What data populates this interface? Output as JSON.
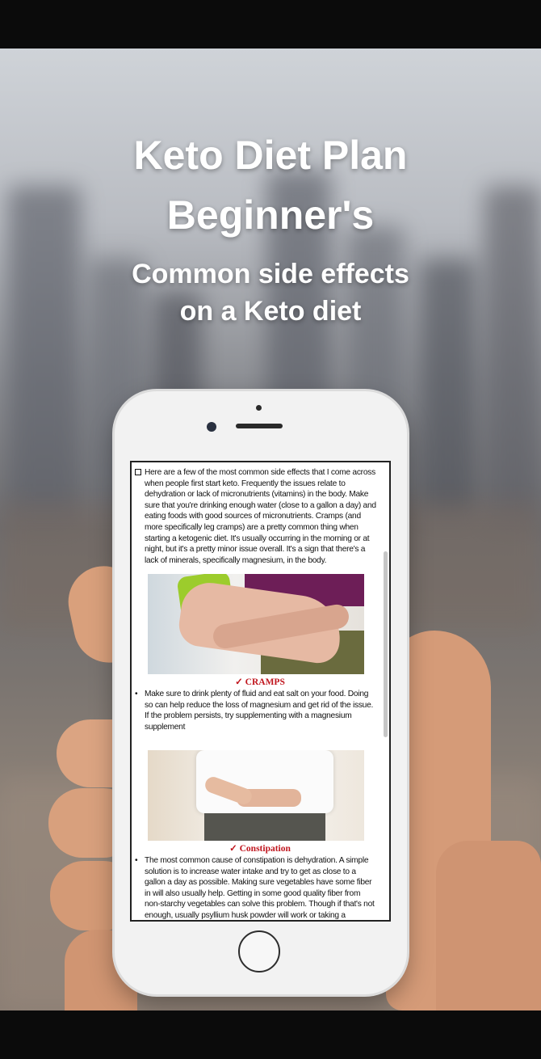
{
  "header": {
    "title_line1": "Keto Diet Plan",
    "title_line2": "Beginner's",
    "subtitle_line1": "Common side effects",
    "subtitle_line2": "on a Keto diet"
  },
  "article": {
    "intro": "Here are a few of the most common side effects that I come across when people first start keto. Frequently the issues relate to dehydration or lack of micronutrients (vitamins) in the body. Make sure that you're drinking enough water (close to a gallon a day) and eating foods with good sources of micronutrients. Cramps (and more specifically leg cramps) are a pretty common thing when starting a ketogenic diet. It's usually occurring in the morning or at night, but it's a pretty minor issue overall. It's a sign that there's a lack of minerals, specifically magnesium, in the body.",
    "caption1": "✓ CRAMPS",
    "bullet1": "Make sure to drink plenty of fluid and eat salt on your food. Doing so can help reduce the loss of magnesium and get rid of the issue. If the problem persists, try supplementing with a magnesium supplement",
    "caption2": "✓ Constipation",
    "bullet2": "The most common cause of constipation is dehydration. A simple solution is to increase water intake and try to get as close to a gallon a day as possible. Making sure vegetables have some fiber in will also usually help. Getting in some good quality fiber from non-starchy vegetables can solve this problem. Though if that's not enough, usually psyllium husk powder will work or taking a probiotic.",
    "bullet_glyph": "•"
  },
  "colors": {
    "caption": "#c0161e",
    "phone_body": "#f2f2f2"
  }
}
